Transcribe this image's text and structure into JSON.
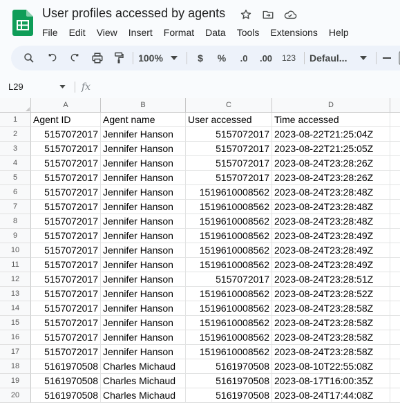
{
  "doc": {
    "title": "User profiles accessed by agents",
    "menu": [
      "File",
      "Edit",
      "View",
      "Insert",
      "Format",
      "Data",
      "Tools",
      "Extensions",
      "Help"
    ],
    "title_icons": [
      "star-icon",
      "move-to-folder-icon",
      "cloud-status-icon"
    ]
  },
  "toolbar": {
    "zoom": "100%",
    "currency": "$",
    "percent": "%",
    "decrease_decimal": ".0",
    "increase_decimal": ".00",
    "number_format": "123",
    "font": "Defaul...",
    "icons": [
      "search-icon",
      "undo-icon",
      "redo-icon",
      "print-icon",
      "paint-format-icon"
    ]
  },
  "formula_bar": {
    "cell_ref": "L29",
    "fx": "fx",
    "value": ""
  },
  "grid": {
    "columns": [
      "A",
      "B",
      "C",
      "D"
    ],
    "header_row": [
      "Agent ID",
      "Agent name",
      "User accessed",
      "Time accessed"
    ],
    "rows": [
      [
        "5157072017",
        "Jennifer Hanson",
        "5157072017",
        "2023-08-22T21:25:04Z"
      ],
      [
        "5157072017",
        "Jennifer Hanson",
        "5157072017",
        "2023-08-22T21:25:05Z"
      ],
      [
        "5157072017",
        "Jennifer Hanson",
        "5157072017",
        "2023-08-24T23:28:26Z"
      ],
      [
        "5157072017",
        "Jennifer Hanson",
        "5157072017",
        "2023-08-24T23:28:26Z"
      ],
      [
        "5157072017",
        "Jennifer Hanson",
        "1519610008562",
        "2023-08-24T23:28:48Z"
      ],
      [
        "5157072017",
        "Jennifer Hanson",
        "1519610008562",
        "2023-08-24T23:28:48Z"
      ],
      [
        "5157072017",
        "Jennifer Hanson",
        "1519610008562",
        "2023-08-24T23:28:48Z"
      ],
      [
        "5157072017",
        "Jennifer Hanson",
        "1519610008562",
        "2023-08-24T23:28:49Z"
      ],
      [
        "5157072017",
        "Jennifer Hanson",
        "1519610008562",
        "2023-08-24T23:28:49Z"
      ],
      [
        "5157072017",
        "Jennifer Hanson",
        "1519610008562",
        "2023-08-24T23:28:49Z"
      ],
      [
        "5157072017",
        "Jennifer Hanson",
        "5157072017",
        "2023-08-24T23:28:51Z"
      ],
      [
        "5157072017",
        "Jennifer Hanson",
        "1519610008562",
        "2023-08-24T23:28:52Z"
      ],
      [
        "5157072017",
        "Jennifer Hanson",
        "1519610008562",
        "2023-08-24T23:28:58Z"
      ],
      [
        "5157072017",
        "Jennifer Hanson",
        "1519610008562",
        "2023-08-24T23:28:58Z"
      ],
      [
        "5157072017",
        "Jennifer Hanson",
        "1519610008562",
        "2023-08-24T23:28:58Z"
      ],
      [
        "5157072017",
        "Jennifer Hanson",
        "1519610008562",
        "2023-08-24T23:28:58Z"
      ],
      [
        "5161970508",
        "Charles Michaud",
        "5161970508",
        "2023-08-10T22:55:08Z"
      ],
      [
        "5161970508",
        "Charles Michaud",
        "5161970508",
        "2023-08-17T16:00:35Z"
      ],
      [
        "5161970508",
        "Charles Michaud",
        "5161970508",
        "2023-08-24T17:44:08Z"
      ]
    ]
  },
  "colors": {
    "logo_green": "#0f9d58",
    "toolbar_bg": "#edf2fa",
    "header_bg": "#f8f9fa",
    "page_bg": "#f9fbfd"
  }
}
